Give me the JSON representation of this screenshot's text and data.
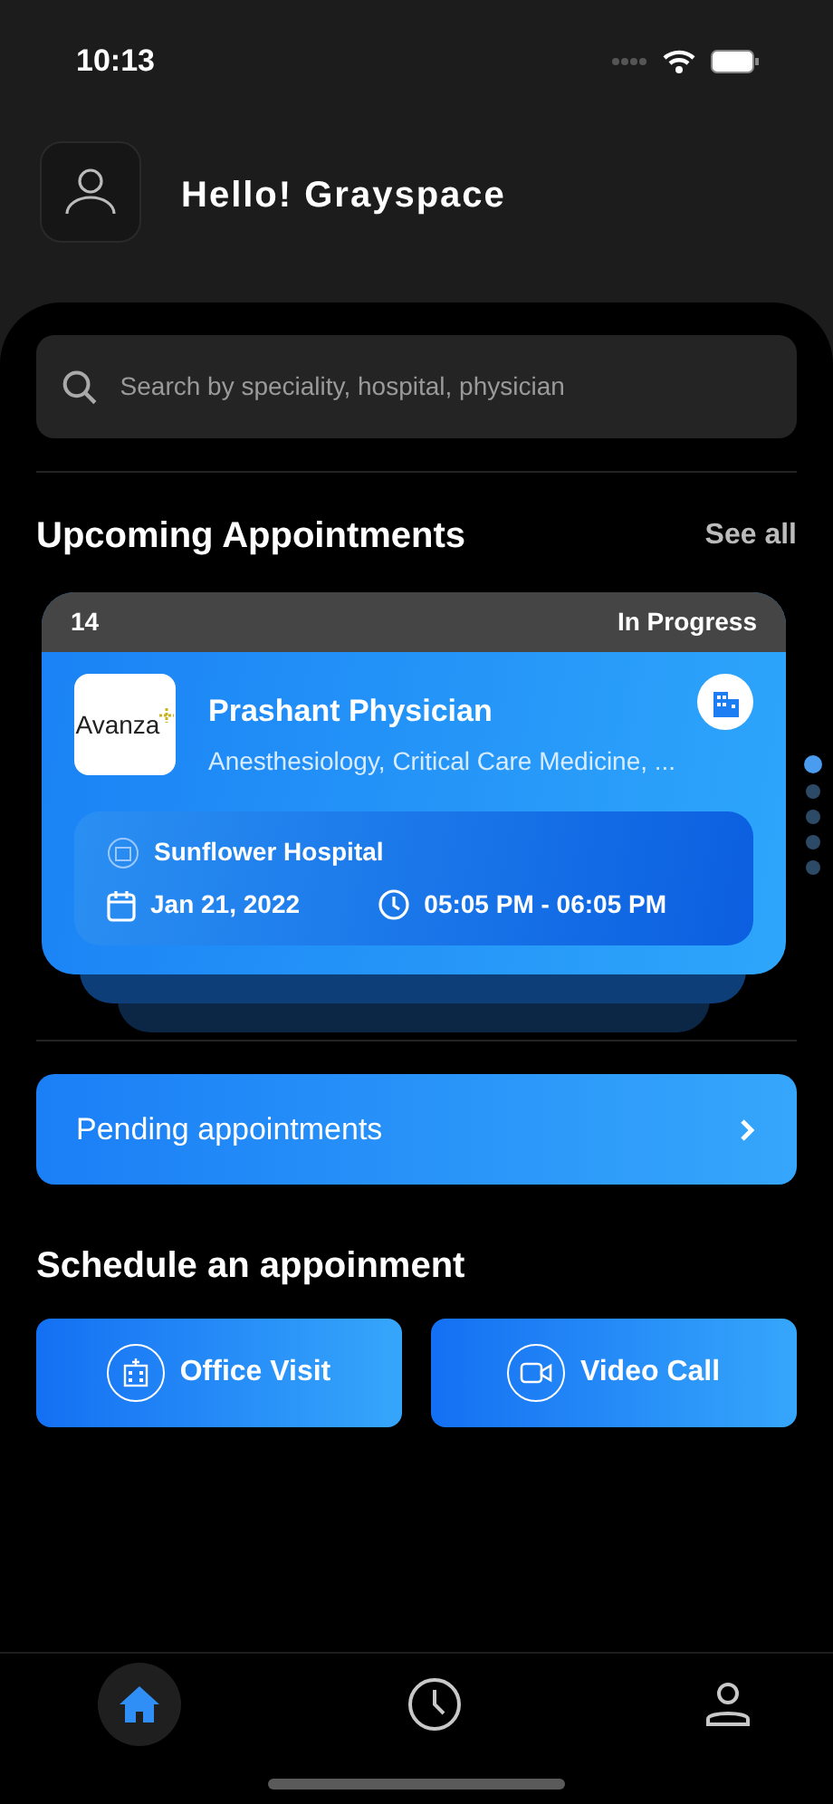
{
  "status_bar": {
    "time": "10:13"
  },
  "header": {
    "greeting": "Hello! Grayspace"
  },
  "search": {
    "placeholder": "Search by speciality, hospital, physician"
  },
  "upcoming": {
    "title": "Upcoming Appointments",
    "see_all": "See all",
    "card": {
      "number": "14",
      "status": "In Progress",
      "logo_text": "Avanza",
      "physician": "Prashant Physician",
      "specialities": "Anesthesiology, Critical Care Medicine, ...",
      "hospital": "Sunflower Hospital",
      "date": "Jan 21, 2022",
      "time": "05:05 PM - 06:05 PM"
    },
    "pager": [
      {
        "selected": true
      },
      {
        "selected": false
      },
      {
        "selected": false
      },
      {
        "selected": false
      },
      {
        "selected": false
      }
    ]
  },
  "pending": {
    "label": "Pending appointments"
  },
  "schedule": {
    "title": "Schedule an appoinment",
    "options": [
      {
        "kind": "office",
        "label": "Office Visit"
      },
      {
        "kind": "video",
        "label": "Video Call"
      }
    ]
  },
  "bottom_nav": [
    {
      "kind": "home",
      "selected": true
    },
    {
      "kind": "history",
      "selected": false
    },
    {
      "kind": "profile",
      "selected": false
    }
  ]
}
